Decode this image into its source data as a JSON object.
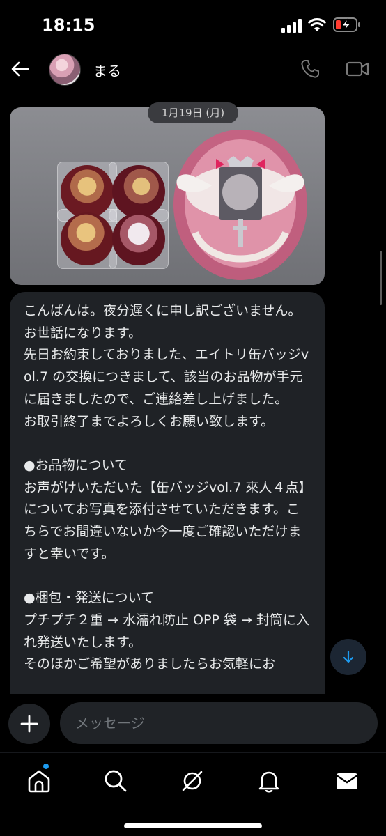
{
  "status_bar": {
    "time": "18:15"
  },
  "header": {
    "name": "まる"
  },
  "chat": {
    "date_separator": "1月19日 (月)",
    "message": "こんばんは。夜分遅くに申し訳ございません。お世話になります。\n先日お約束しておりました、エイトリ缶バッジvol.7 の交換につきまして、該当のお品物が手元に届きましたので、ご連絡差し上げました。\nお取引終了までよろしくお願い致します。\n\n●お品物について\nお声がけいただいた【缶バッジvol.7 來人４点】についてお写真を添付させていただきます。こちらでお間違いないか今一度ご確認いただけますと幸いです。\n\n●梱包・発送について\nプチプチ２重 → 水濡れ防止 OPP 袋 → 封筒に入れ発送いたします。\nそのほかご希望がありましたらお気軽にお"
  },
  "composer": {
    "placeholder": "メッセージ"
  },
  "colors": {
    "accent": "#1d9bf0",
    "bubble": "#1f2226",
    "background": "#000000"
  },
  "icons": [
    "back-arrow-icon",
    "phone-icon",
    "video-icon",
    "plus-icon",
    "arrow-down-icon",
    "home-icon",
    "search-icon",
    "grok-icon",
    "bell-icon",
    "mail-icon"
  ]
}
